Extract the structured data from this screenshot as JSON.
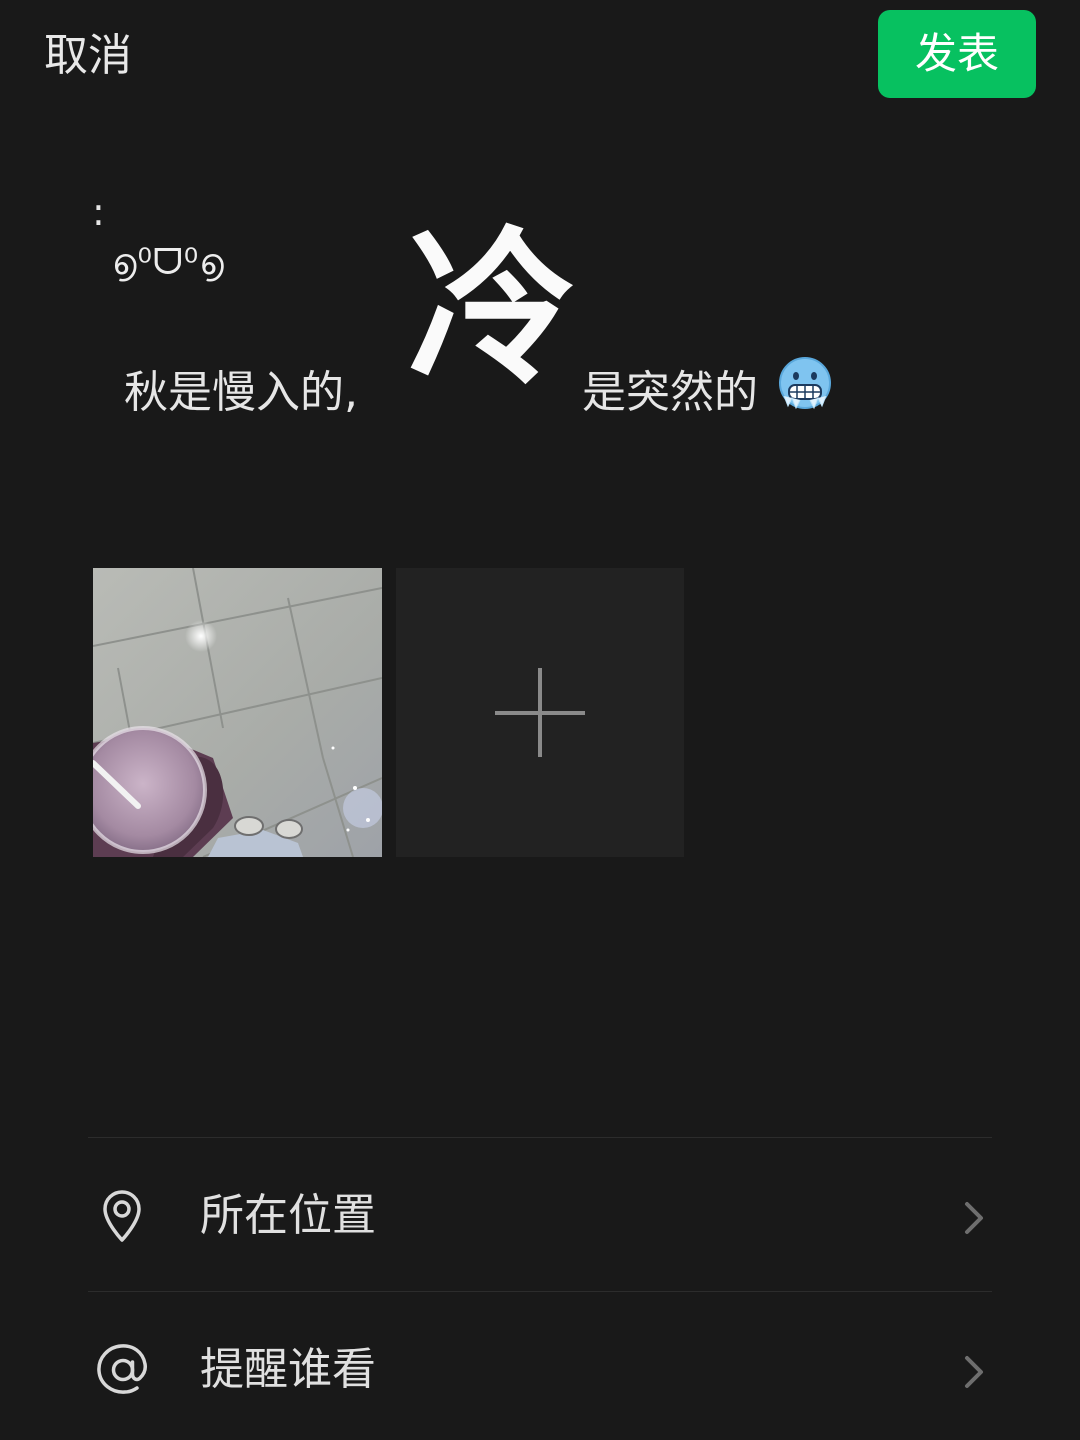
{
  "header": {
    "cancel_label": "取消",
    "publish_label": "发表",
    "publish_color": "#07c160"
  },
  "post": {
    "colon": ":",
    "kaomoji": "൭⁰ᗜ⁰൭",
    "text_before": "秋是慢入的,",
    "highlight": "冷",
    "text_after": "是突然的",
    "emoji": "freezing-face"
  },
  "media": {
    "photo_icon": "photo-thumbnail",
    "add_icon": "plus-icon"
  },
  "options": [
    {
      "label": "所在位置",
      "icon": "location-pin-icon"
    },
    {
      "label": "提醒谁看",
      "icon": "at-sign-icon"
    }
  ]
}
